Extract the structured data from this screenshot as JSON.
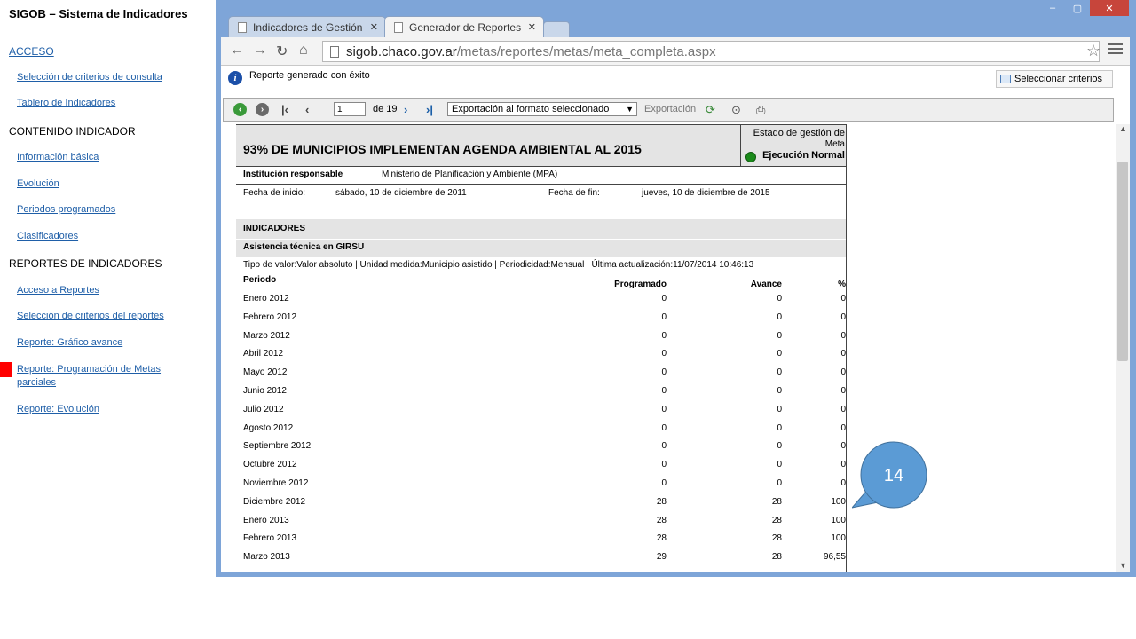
{
  "sidebar": {
    "title": "SIGOB – Sistema de Indicadores",
    "acceso": "ACCESO",
    "links_top": [
      "Selección de criterios de consulta",
      "Tablero de Indicadores"
    ],
    "section_contenido": "CONTENIDO INDICADOR",
    "links_contenido": [
      "Información básica",
      "Evolución",
      "Periodos programados",
      "Clasificadores"
    ],
    "section_reportes": "REPORTES DE INDICADORES",
    "links_reportes": [
      "Acceso a Reportes",
      "Selección de criterios del reportes",
      "Reporte: Gráfico avance",
      "Reporte: Programación de Metas parciales",
      "Reporte: Evolución"
    ]
  },
  "browser": {
    "tabs": [
      {
        "label": "Indicadores de Gestión"
      },
      {
        "label": "Generador de Reportes"
      }
    ],
    "url_host": "sigob.chaco.gov.ar",
    "url_path": "/metas/reportes/metas/meta_completa.aspx",
    "window_buttons": {
      "minimize": "–",
      "restore": "▢",
      "close": "✕"
    }
  },
  "status": {
    "message": "Reporte generado con éxito",
    "criteria_button": "Seleccionar criterios"
  },
  "report_toolbar": {
    "page_value": "1",
    "page_of": "de 19",
    "format_selected": "Exportación al formato seleccionado",
    "export_label": "Exportación"
  },
  "report": {
    "title": "93% DE MUNICIPIOS IMPLEMENTAN AGENDA AMBIENTAL AL 2015",
    "status_label": "Estado de gestión de",
    "status_sub": "Meta",
    "status_value": "Ejecución Normal",
    "status_color": "#1a8a1a",
    "institucion_label": "Institución responsable",
    "institucion_value": "Ministerio de Planificación y Ambiente (MPA)",
    "fecha_inicio_label": "Fecha de inicio:",
    "fecha_inicio_value": "sábado, 10 de diciembre de 2011",
    "fecha_fin_label": "Fecha de fin:",
    "fecha_fin_value": "jueves, 10 de diciembre de 2015",
    "indicadores_label": "INDICADORES",
    "indicator_name": "Asistencia técnica en GIRSU",
    "indicator_meta": "Tipo de valor:Valor absoluto | Unidad medida:Municipio asistido | Periodicidad:Mensual | Última actualización:11/07/2014 10:46:13",
    "table": {
      "headers": [
        "Periodo",
        "Programado",
        "Avance",
        "%"
      ],
      "rows": [
        [
          "Enero 2012",
          "0",
          "0",
          "0"
        ],
        [
          "Febrero 2012",
          "0",
          "0",
          "0"
        ],
        [
          "Marzo 2012",
          "0",
          "0",
          "0"
        ],
        [
          "Abril 2012",
          "0",
          "0",
          "0"
        ],
        [
          "Mayo 2012",
          "0",
          "0",
          "0"
        ],
        [
          "Junio 2012",
          "0",
          "0",
          "0"
        ],
        [
          "Julio 2012",
          "0",
          "0",
          "0"
        ],
        [
          "Agosto 2012",
          "0",
          "0",
          "0"
        ],
        [
          "Septiembre 2012",
          "0",
          "0",
          "0"
        ],
        [
          "Octubre 2012",
          "0",
          "0",
          "0"
        ],
        [
          "Noviembre 2012",
          "0",
          "0",
          "0"
        ],
        [
          "Diciembre 2012",
          "28",
          "28",
          "100"
        ],
        [
          "Enero 2013",
          "28",
          "28",
          "100"
        ],
        [
          "Febrero 2013",
          "28",
          "28",
          "100"
        ],
        [
          "Marzo 2013",
          "29",
          "28",
          "96,55"
        ]
      ]
    }
  },
  "callout": {
    "number": "14",
    "color": "#5b9bd5"
  }
}
